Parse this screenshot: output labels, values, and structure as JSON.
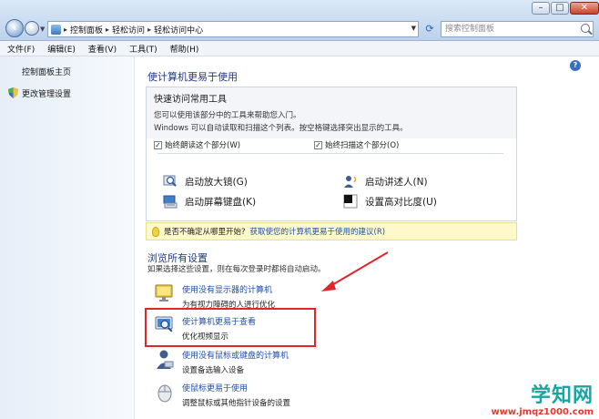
{
  "titlebar": {
    "breadcrumbs": [
      "控制面板",
      "轻松访问",
      "轻松访问中心"
    ],
    "search_placeholder": "搜索控制面板"
  },
  "menu": [
    "文件(F)",
    "编辑(E)",
    "查看(V)",
    "工具(T)",
    "帮助(H)"
  ],
  "sidebar": {
    "items": [
      {
        "label": "控制面板主页"
      },
      {
        "label": "更改管理设置"
      }
    ]
  },
  "main": {
    "heading": "使计算机更易于使用",
    "quick": {
      "title": "快速访问常用工具",
      "line1": "您可以使用该部分中的工具来帮助您入门。",
      "line2": "Windows 可以自动读取和扫描这个列表。按空格键选择突出显示的工具。",
      "check_read": "始终朗读这个部分(W)",
      "check_scan": "始终扫描这个部分(O)",
      "tools": [
        {
          "label": "启动放大镜(G)",
          "icon": "magnifier-icon"
        },
        {
          "label": "启动讲述人(N)",
          "icon": "narrator-icon"
        },
        {
          "label": "启动屏幕键盘(K)",
          "icon": "keyboard-icon"
        },
        {
          "label": "设置高对比度(U)",
          "icon": "contrast-icon"
        }
      ]
    },
    "tip": {
      "question": "是否不确定从哪里开始?",
      "link": "获取使您的计算机更易于使用的建议(R)"
    },
    "browse_heading": "浏览所有设置",
    "browse_desc": "如果选择这些设置，则在每次登录时都将自动启动。",
    "settings": [
      {
        "link": "使用没有显示器的计算机",
        "desc": "为有视力障碍的人进行优化",
        "icon": "display-icon"
      },
      {
        "link": "使计算机更易于查看",
        "desc": "优化视频显示",
        "icon": "magnify-screen-icon"
      },
      {
        "link": "使用没有鼠标或键盘的计算机",
        "desc": "设置备选输入设备",
        "icon": "user-icon"
      },
      {
        "link": "使鼠标更易于使用",
        "desc": "调整鼠标或其他指针设备的设置",
        "icon": "mouse-icon"
      }
    ]
  },
  "watermark": {
    "logo": "学知网",
    "url": "www.jmqz1000.com"
  },
  "colors": {
    "link": "#1e4fa8",
    "heading": "#1e3a8a",
    "highlight_box": "#e0262a",
    "tip_bg": "#fdf9c9"
  }
}
